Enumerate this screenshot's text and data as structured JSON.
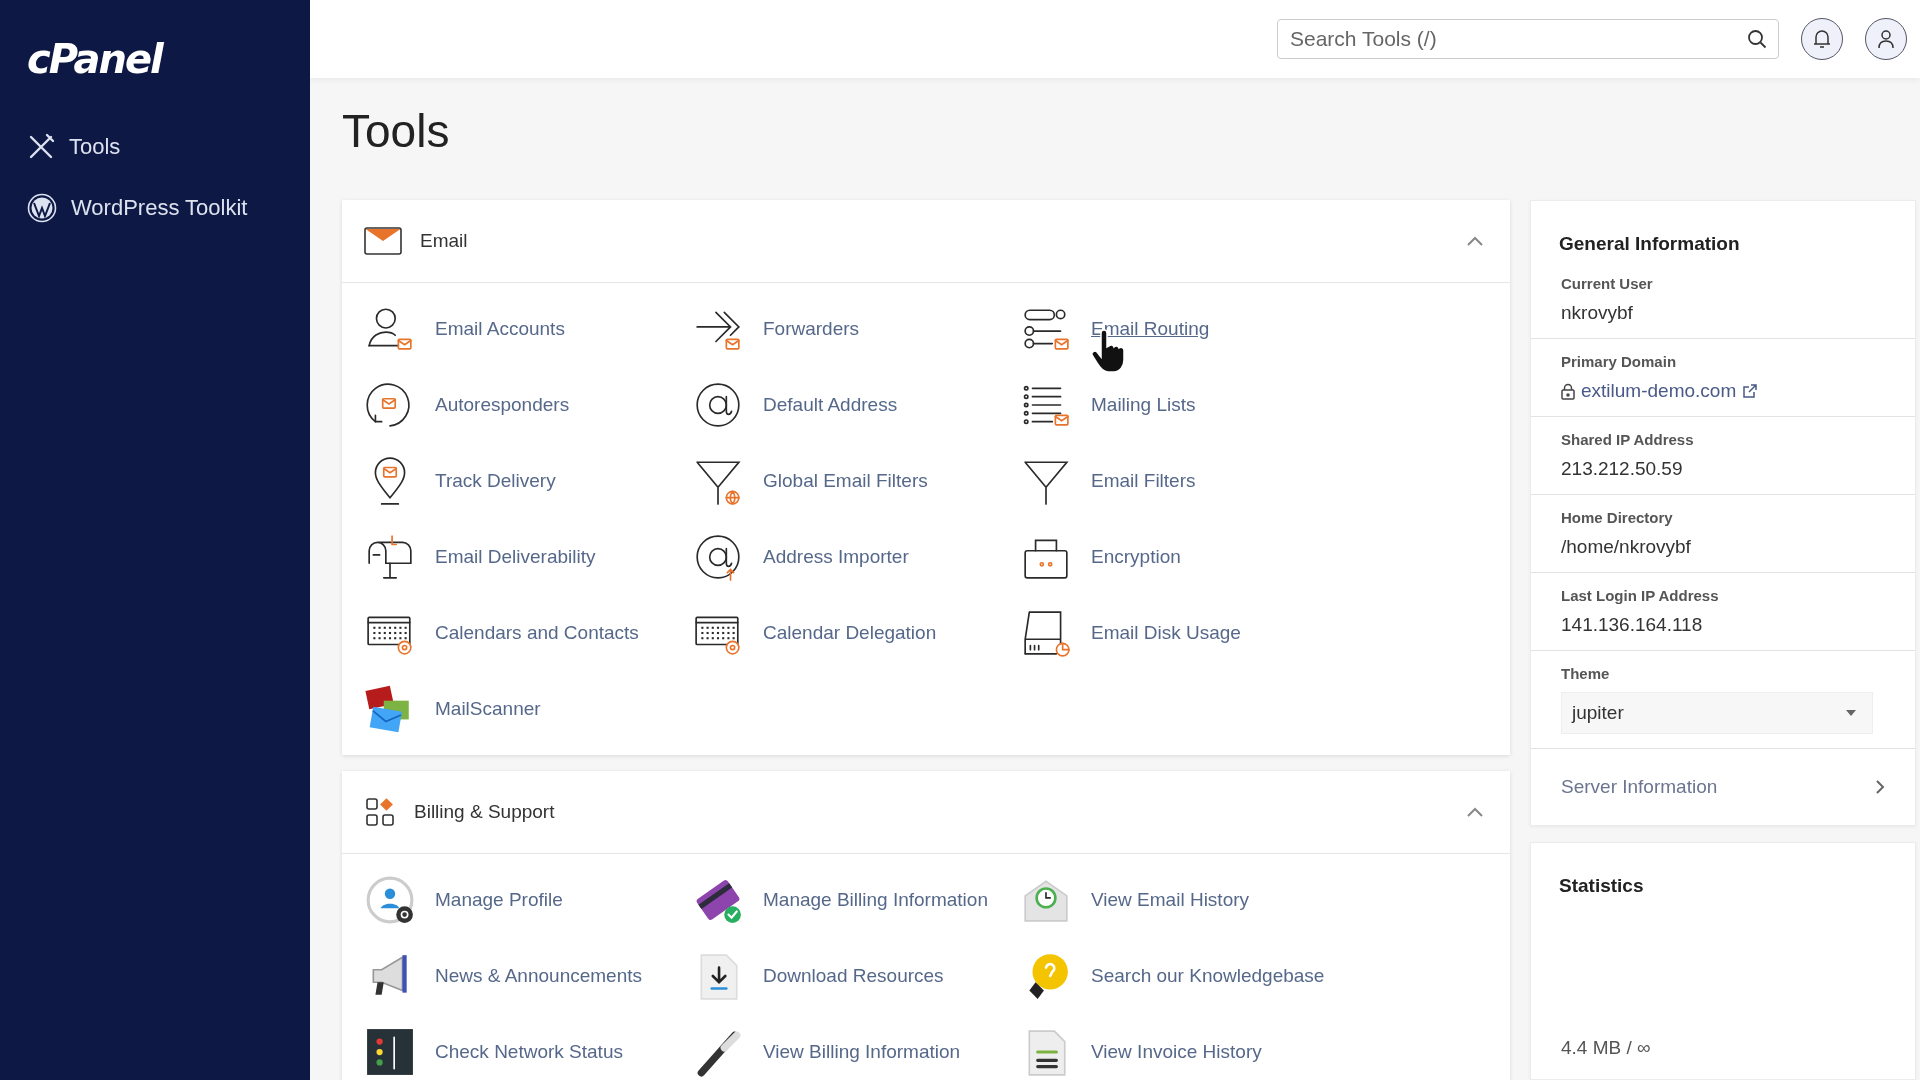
{
  "sidebar": {
    "logo": "cPanel",
    "items": [
      {
        "label": "Tools"
      },
      {
        "label": "WordPress Toolkit"
      }
    ]
  },
  "header": {
    "search": {
      "placeholder": "Search Tools (/)"
    }
  },
  "page_title": "Tools",
  "sections": [
    {
      "title": "Email",
      "expanded": true,
      "tools": [
        {
          "label": "Email Accounts",
          "hovered": false
        },
        {
          "label": "Forwarders",
          "hovered": false
        },
        {
          "label": "Email Routing",
          "hovered": true
        },
        {
          "label": "Autoresponders",
          "hovered": false
        },
        {
          "label": "Default Address",
          "hovered": false
        },
        {
          "label": "Mailing Lists",
          "hovered": false
        },
        {
          "label": "Track Delivery",
          "hovered": false
        },
        {
          "label": "Global Email Filters",
          "hovered": false
        },
        {
          "label": "Email Filters",
          "hovered": false
        },
        {
          "label": "Email Deliverability",
          "hovered": false
        },
        {
          "label": "Address Importer",
          "hovered": false
        },
        {
          "label": "Encryption",
          "hovered": false
        },
        {
          "label": "Calendars and Contacts",
          "hovered": false
        },
        {
          "label": "Calendar Delegation",
          "hovered": false
        },
        {
          "label": "Email Disk Usage",
          "hovered": false
        },
        {
          "label": "MailScanner",
          "hovered": false
        }
      ]
    },
    {
      "title": "Billing & Support",
      "expanded": true,
      "tools": [
        {
          "label": "Manage Profile",
          "hovered": false
        },
        {
          "label": "Manage Billing Information",
          "hovered": false
        },
        {
          "label": "View Email History",
          "hovered": false
        },
        {
          "label": "News & Announcements",
          "hovered": false
        },
        {
          "label": "Download Resources",
          "hovered": false
        },
        {
          "label": "Search our Knowledgebase",
          "hovered": false
        },
        {
          "label": "Check Network Status",
          "hovered": false
        },
        {
          "label": "View Billing Information",
          "hovered": false
        },
        {
          "label": "View Invoice History",
          "hovered": false
        }
      ]
    }
  ],
  "general_information": {
    "title": "General Information",
    "fields": [
      {
        "label": "Current User",
        "value": "nkrovybf",
        "kind": "text"
      },
      {
        "label": "Primary Domain",
        "value": "extilum-demo.com",
        "kind": "link"
      },
      {
        "label": "Shared IP Address",
        "value": "213.212.50.59",
        "kind": "text"
      },
      {
        "label": "Home Directory",
        "value": "/home/nkrovybf",
        "kind": "text"
      },
      {
        "label": "Last Login IP Address",
        "value": "141.136.164.118",
        "kind": "text"
      },
      {
        "label": "Theme",
        "value": "jupiter",
        "kind": "select"
      }
    ],
    "server_information": "Server Information"
  },
  "statistics": {
    "title": "Statistics",
    "value": "4.4 MB / ∞"
  }
}
